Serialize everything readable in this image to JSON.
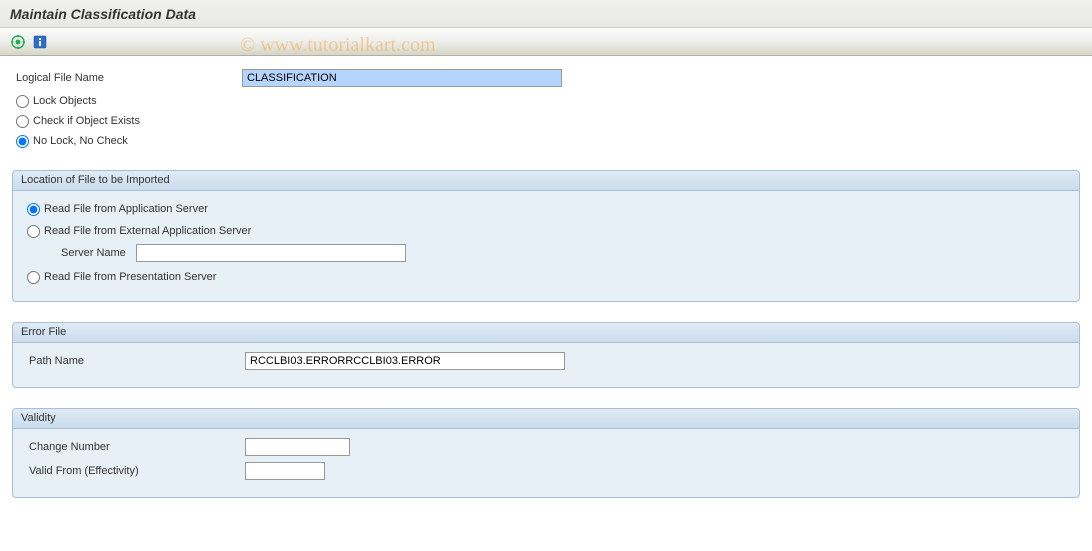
{
  "header": {
    "title": "Maintain Classification Data"
  },
  "toolbar": {
    "execute_name": "execute-icon",
    "info_name": "info-icon"
  },
  "fields": {
    "logical_file_name": {
      "label": "Logical File Name",
      "value": "CLASSIFICATION"
    }
  },
  "lock_options": {
    "lock_objects": "Lock Objects",
    "check_exists": "Check if Object Exists",
    "no_lock": "No Lock, No Check"
  },
  "location_group": {
    "title": "Location of File to be Imported",
    "app_server": "Read File from Application Server",
    "ext_server": "Read File from External Application Server",
    "server_name_label": "Server Name",
    "server_name_value": "",
    "presentation": "Read File from Presentation Server"
  },
  "error_file": {
    "title": "Error File",
    "path_label": "Path Name",
    "path_value": "RCCLBI03.ERRORRCCLBI03.ERROR"
  },
  "validity": {
    "title": "Validity",
    "change_number_label": "Change Number",
    "change_number_value": "",
    "valid_from_label": "Valid From (Effectivity)",
    "valid_from_value": ""
  },
  "watermark": "© www.tutorialkart.com"
}
